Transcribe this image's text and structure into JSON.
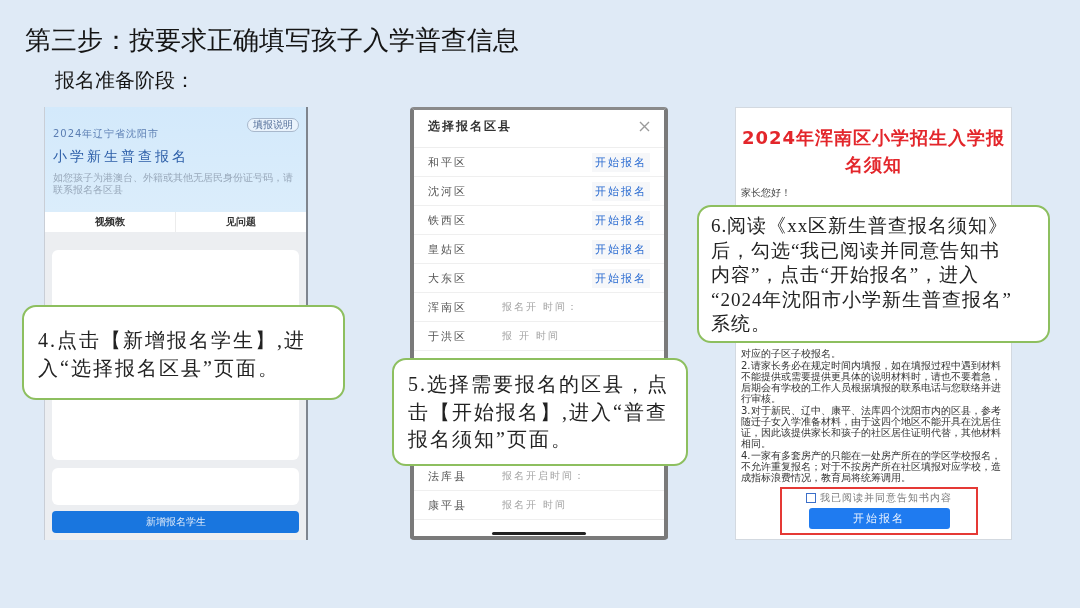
{
  "slide": {
    "title": "第三步：按要求正确填写孩子入学普查信息",
    "subtitle": "报名准备阶段："
  },
  "panels": [
    {
      "kind": "home",
      "location": "2024年辽宁省沈阳市",
      "help_badge": "填报说明",
      "heading": "小学新生普查报名",
      "notice": "如您孩子为港澳台、外籍或其他无居民身份证号码，请联系报名各区县",
      "tabs": [
        {
          "label": "视频教"
        },
        {
          "label": "见问题"
        }
      ],
      "add_button": "新增报名学生",
      "step_note": "4.点击【新增报名学生】,进入“选择报名区县”页面。"
    },
    {
      "kind": "district_picker",
      "title": "选择报名区县",
      "rows_above_note": [
        {
          "kind": "open",
          "district": "和平区",
          "action": "开始报名"
        },
        {
          "kind": "open",
          "district": "沈河区",
          "action": "开始报名"
        },
        {
          "kind": "open",
          "district": "铁西区",
          "action": "开始报名"
        },
        {
          "kind": "open",
          "district": "皇姑区",
          "action": "开始报名"
        },
        {
          "kind": "open",
          "district": "大东区",
          "action": "开始报名"
        },
        {
          "kind": "scheduled",
          "district": "浑南区",
          "note": "报名开 时间："
        },
        {
          "kind": "scheduled",
          "district": "于洪区",
          "note": "报 开 时间"
        }
      ],
      "rows_below_note": [
        {
          "kind": "scheduled",
          "district": "法库县",
          "note": "报名开启时间："
        },
        {
          "kind": "scheduled",
          "district": "康平县",
          "note": "报名开 时间"
        }
      ],
      "step_note": "5.选择需要报名的区县，点击【开始报名】,进入“普查报名须知”页面。"
    },
    {
      "kind": "notice",
      "heading": "2024年浑南区小学招生入学报名须知",
      "greeting": "家长您好！",
      "paragraphs": [
        "对应的子区子校报名。",
        "2.请家长务必在规定时间内填报，如在填报过程中遇到材料不能提供或需要提供更具体的说明材料时，请也不要着急，后期会有学校的工作人员根据填报的联系电话与您联络并进行审核。",
        "3.对于新民、辽中、康平、法库四个沈阳市内的区县，参考随迁子女入学准备材料，由于这四个地区不能开具在沈居住证，因此该提供家长和孩子的社区居住证明代替，其他材料相同。",
        "4.一家有多套房产的只能在一处房产所在的学区学校报名，不允许重复报名；对于不按房产所在社区填报对应学校，造成指标浪费情况，教育局将统筹调用。"
      ],
      "agreement": {
        "label": "我已阅读并同意告知书内容",
        "checked": false
      },
      "start_button": "开始报名",
      "step_note": "6.阅读《xx区新生普查报名须知》后，勾选“我已阅读并同意告知书内容”，点击“开始报名”，进入“2024年沈阳市小学新生普查报名”系统。"
    }
  ]
}
